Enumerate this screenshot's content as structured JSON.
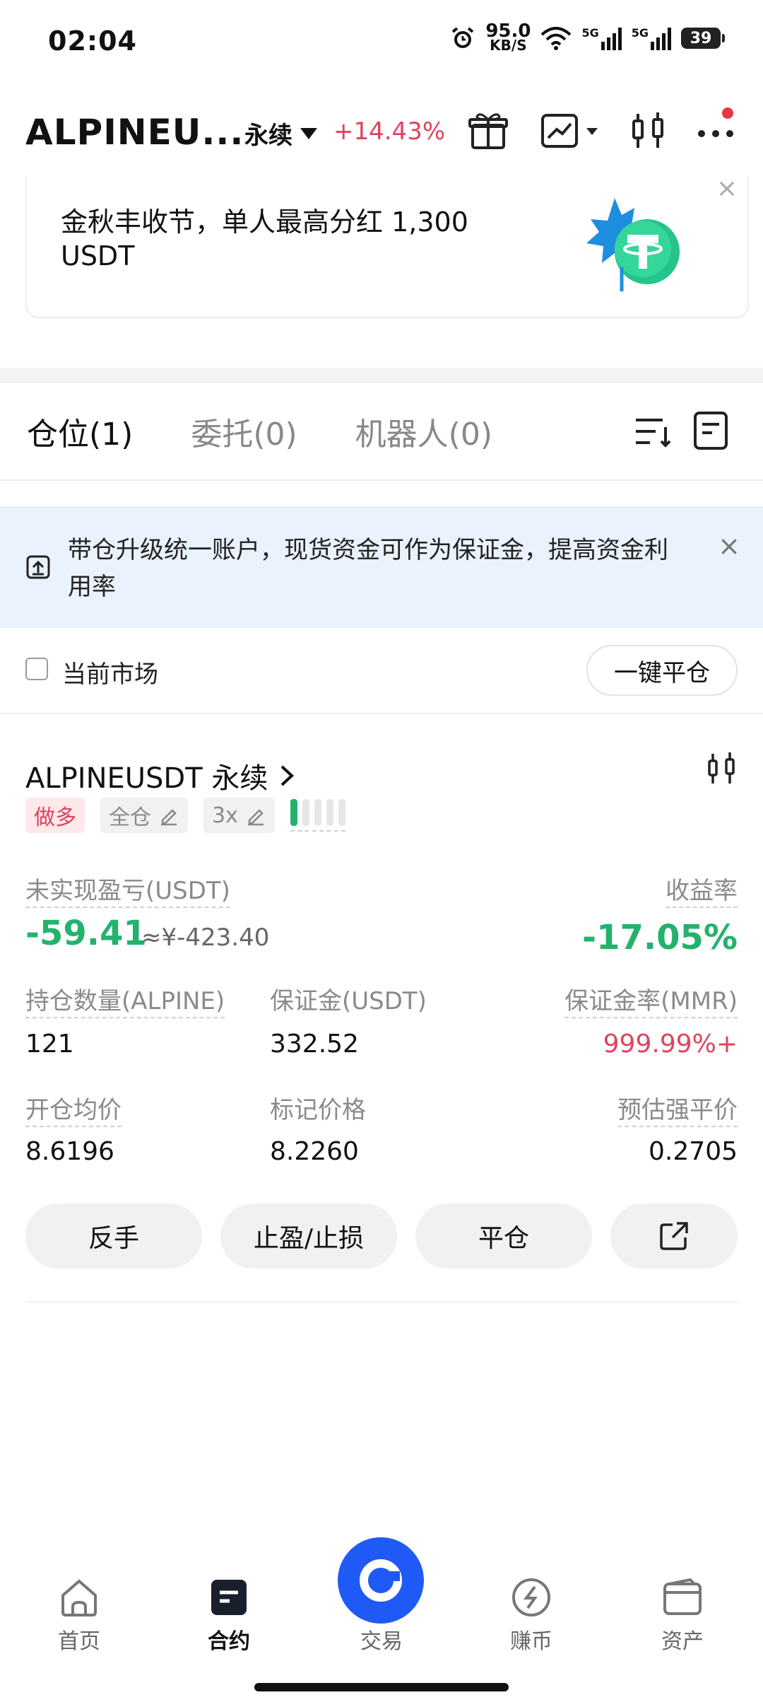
{
  "status_bar": {
    "time": "02:04",
    "net_speed": "95.0",
    "net_unit": "KB/S",
    "sig1": "5G",
    "sig2": "5G",
    "battery": "39"
  },
  "header": {
    "title": "ALPINEU...",
    "contract_type": "永续",
    "change": "+14.43%"
  },
  "promo": {
    "text": "金秋丰收节，单人最高分红 1,300 USDT",
    "close": "×"
  },
  "tabs": [
    {
      "label": "仓位(1)",
      "active": true
    },
    {
      "label": "委托(0)",
      "active": false
    },
    {
      "label": "机器人(0)",
      "active": false
    }
  ],
  "notice": {
    "text": "带仓升级统一账户，现货资金可作为保证金，提高资金利用率",
    "close": "×"
  },
  "filter": {
    "current_market_label": "当前市场",
    "close_all_label": "一键平仓"
  },
  "position": {
    "symbol": "ALPINEUSDT 永续",
    "tags": {
      "side": "做多",
      "margin_mode": "全仓",
      "leverage": "3x"
    },
    "risk_level": 1,
    "unrealized_pnl_label": "未实现盈亏(USDT)",
    "unrealized_pnl": "-59.41",
    "unrealized_pnl_cny": "≈¥-423.40",
    "roe_label": "收益率",
    "roe": "-17.05%",
    "size_label": "持仓数量(ALPINE)",
    "size": "121",
    "margin_label": "保证金(USDT)",
    "margin": "332.52",
    "mmr_label": "保证金率(MMR)",
    "mmr": "999.99%+",
    "entry_label": "开仓均价",
    "entry": "8.6196",
    "mark_label": "标记价格",
    "mark": "8.2260",
    "liq_label": "预估强平价",
    "liq": "0.2705"
  },
  "actions": {
    "reverse": "反手",
    "tp_sl": "止盈/止损",
    "close": "平仓"
  },
  "bottom_nav": [
    {
      "label": "首页",
      "icon": "home-icon"
    },
    {
      "label": "合约",
      "icon": "contract-icon",
      "active": true
    },
    {
      "label": "交易",
      "icon": "trade-icon"
    },
    {
      "label": "赚币",
      "icon": "earn-icon"
    },
    {
      "label": "资产",
      "icon": "wallet-icon"
    }
  ],
  "colors": {
    "up": "#23b26d",
    "down": "#e0435d",
    "accent": "#1f5af6",
    "notice_bg": "#eaf2fd"
  }
}
